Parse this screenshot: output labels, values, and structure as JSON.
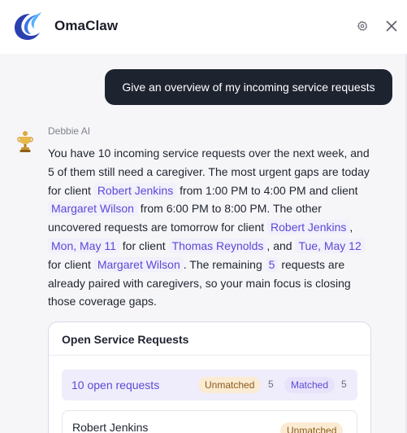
{
  "header": {
    "app_name": "OmaClaw",
    "icons": {
      "logo": "omaclaw-swirl-logo",
      "settings": "gear-icon",
      "close": "close-icon"
    },
    "colors": {
      "logo_dark": "#2a3fb0",
      "logo_light": "#4fb3ff"
    }
  },
  "chat": {
    "user_message": "Give an overview of my incoming service requests",
    "assistant": {
      "name": "Debbie AI",
      "avatar_icon": "trophy-avatar-icon",
      "message": {
        "t1": "You have 10 incoming service requests over the next week, and 5 of them still need a caregiver. The most urgent gaps are today for client ",
        "chip1": "Robert Jenkins",
        "t2": " from 1:00 PM to 4:00 PM and client ",
        "chip2": "Margaret Wilson",
        "t3": " from 6:00 PM to 8:00 PM. The other uncovered requests are tomorrow for client ",
        "chip3": "Robert Jenkins",
        "t4": ", ",
        "chip4": "Mon, May 11",
        "t5": " for client ",
        "chip5": "Thomas Reynolds",
        "t6": ", and ",
        "chip6": "Tue, May 12",
        "t7": " for client ",
        "chip7": "Margaret Wilson",
        "t8": ". The remaining ",
        "chip8": "5",
        "t9": " requests are already paired with caregivers, so your main focus is closing those coverage gaps."
      },
      "card": {
        "title": "Open Service Requests",
        "summary": {
          "label": "10 open requests",
          "unmatched_label": "Unmatched",
          "unmatched_count": "5",
          "matched_label": "Matched",
          "matched_count": "5"
        },
        "rows": [
          {
            "name": "Robert Jenkins",
            "status": "Unmatched"
          }
        ]
      }
    }
  },
  "colors": {
    "accent": "#5b49d6",
    "chip_bg": "#f1f0fb",
    "user_bubble": "#1e2330",
    "unmatched_bg": "#fbebd3",
    "matched_bg": "#e8e3fa",
    "chat_bg": "#f6f6f8"
  }
}
